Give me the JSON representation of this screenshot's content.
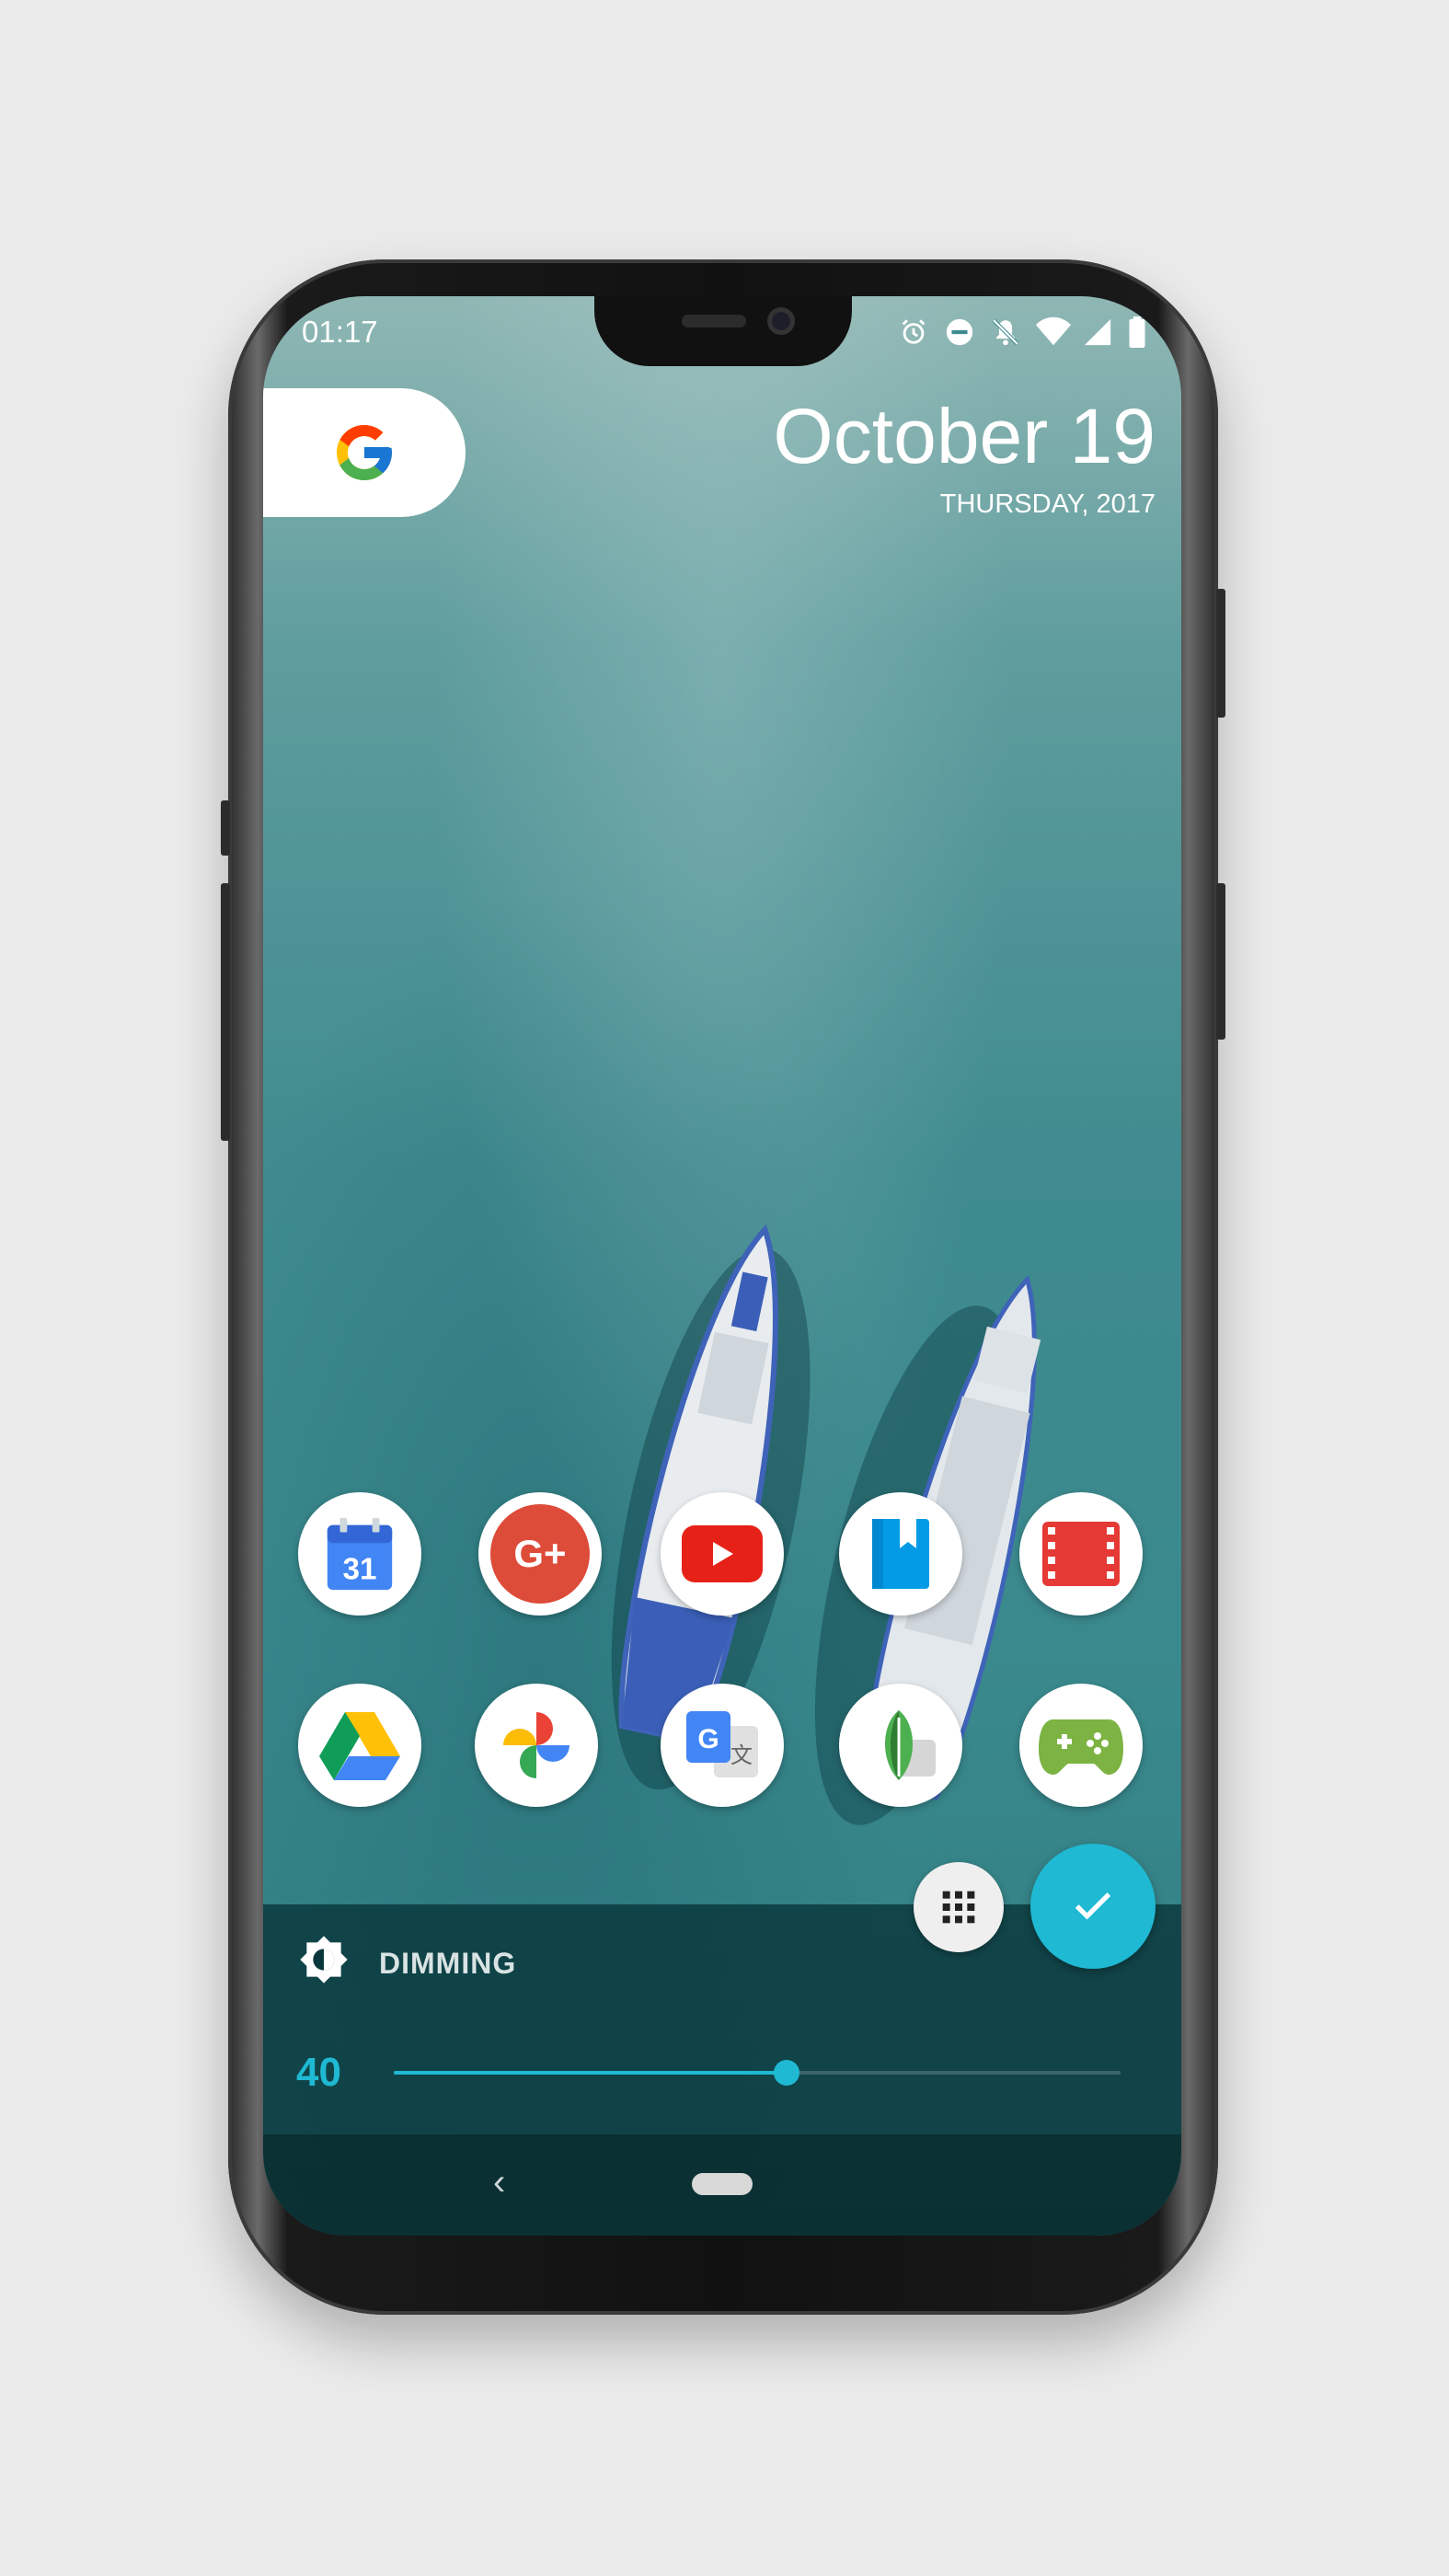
{
  "status_bar": {
    "time": "01:17",
    "icons": [
      "alarm-icon",
      "do-not-disturb-icon",
      "notifications-off-icon",
      "wifi-icon",
      "signal-icon",
      "battery-icon"
    ]
  },
  "widget": {
    "search_logo": "G",
    "date": "October 19",
    "day": "THURSDAY, 2017"
  },
  "apps": {
    "row1": [
      "calendar-icon",
      "google-plus-icon",
      "youtube-icon",
      "play-books-icon",
      "play-movies-icon"
    ],
    "row2": [
      "google-drive-icon",
      "google-photos-icon",
      "google-translate-icon",
      "snapseed-icon",
      "play-games-icon"
    ],
    "calendar_day": "31",
    "google_plus_text": "G+"
  },
  "dimming": {
    "label": "DIMMING",
    "value": "40",
    "level_fraction": 0.54
  },
  "colors": {
    "accent": "#1fb9d3",
    "panel": "#0a373c"
  },
  "nav": {
    "back": "‹"
  }
}
